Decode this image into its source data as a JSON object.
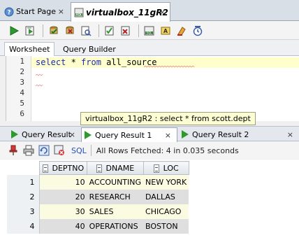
{
  "doc_tabs": {
    "start_page": "Start Page",
    "connection": "virtualbox_11gR2",
    "close_glyph": "×"
  },
  "toolbar": {
    "icons": [
      "run-statement-icon",
      "run-script-icon",
      "commit-icon",
      "rollback-icon",
      "explain-plan-icon",
      "autotrace-icon",
      "sql-tuning-icon",
      "unshared-sql-icon",
      "clear-icon",
      "history-icon"
    ]
  },
  "sub_tabs": {
    "worksheet": "Worksheet",
    "query_builder": "Query Builder"
  },
  "editor": {
    "lines": [
      {
        "no": "1",
        "kw1": "select",
        "mid": " * ",
        "kw2": "from",
        "rest": " all_source"
      },
      {
        "no": "2"
      },
      {
        "no": "3"
      },
      {
        "no": "4"
      },
      {
        "no": "5"
      },
      {
        "no": "6"
      }
    ]
  },
  "tooltip": "virtualbox_11gR2 : select * from scott.dept",
  "result_tabs": {
    "tab1": "Query Result",
    "tab2": "Query Result 1",
    "tab3": "Query Result 2"
  },
  "results_toolbar": {
    "sql_label": "SQL",
    "status": "All Rows Fetched: 4 in 0.035 seconds"
  },
  "grid": {
    "columns": [
      "DEPTNO",
      "DNAME",
      "LOC"
    ],
    "rows": [
      {
        "num": "1",
        "deptno": "10",
        "dname": "ACCOUNTING",
        "loc": "NEW YORK"
      },
      {
        "num": "2",
        "deptno": "20",
        "dname": "RESEARCH",
        "loc": "DALLAS"
      },
      {
        "num": "3",
        "deptno": "30",
        "dname": "SALES",
        "loc": "CHICAGO"
      },
      {
        "num": "4",
        "deptno": "40",
        "dname": "OPERATIONS",
        "loc": "BOSTON"
      }
    ]
  },
  "colors": {
    "keyword": "#1d2bb5",
    "current_line": "#ffffcc",
    "run_green": "#2e9a2e",
    "sql_link": "#2250b8"
  }
}
